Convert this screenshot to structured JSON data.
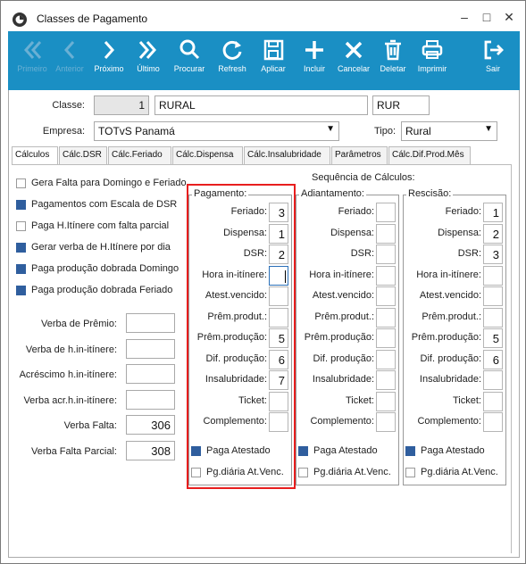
{
  "window": {
    "title": "Classes de Pagamento"
  },
  "toolbar": {
    "items": [
      {
        "label": "Primeiro",
        "icon": "first-icon",
        "enabled": false
      },
      {
        "label": "Anterior",
        "icon": "previous-icon",
        "enabled": false
      },
      {
        "label": "Próximo",
        "icon": "next-icon",
        "enabled": true
      },
      {
        "label": "Último",
        "icon": "last-icon",
        "enabled": true
      },
      {
        "label": "Procurar",
        "icon": "search-icon",
        "enabled": true
      },
      {
        "label": "Refresh",
        "icon": "refresh-icon",
        "enabled": true
      },
      {
        "label": "Aplicar",
        "icon": "save-icon",
        "enabled": true
      },
      {
        "label": "Incluir",
        "icon": "add-icon",
        "enabled": true
      },
      {
        "label": "Cancelar",
        "icon": "cancel-icon",
        "enabled": true
      },
      {
        "label": "Deletar",
        "icon": "trash-icon",
        "enabled": true
      },
      {
        "label": "Imprimir",
        "icon": "print-icon",
        "enabled": true
      },
      {
        "label": "Sair",
        "icon": "exit-icon",
        "enabled": true
      }
    ]
  },
  "form": {
    "classe_label": "Classe:",
    "classe_code": "1",
    "classe_name": "RURAL",
    "classe_abbr": "RUR",
    "empresa_label": "Empresa:",
    "empresa_value": "TOTvS Panamá",
    "tipo_label": "Tipo:",
    "tipo_value": "Rural"
  },
  "tabs": [
    "Cálculos",
    "Cálc.DSR",
    "Cálc.Feriado",
    "Cálc.Dispensa",
    "Cálc.Insalubridade",
    "Parâmetros",
    "Cálc.Dif.Prod.Mês"
  ],
  "checks": [
    {
      "label": "Gera Falta para Domingo e Feriado",
      "checked": false
    },
    {
      "label": "Pagamentos com Escala de DSR",
      "checked": true
    },
    {
      "label": "Paga H.Itínere com falta parcial",
      "checked": false
    },
    {
      "label": "Gerar verba de H.Itínere por dia",
      "checked": true
    },
    {
      "label": "Paga produção dobrada Domingo",
      "checked": true
    },
    {
      "label": "Paga produção dobrada Feriado",
      "checked": true
    }
  ],
  "verbas": [
    {
      "label": "Verba de Prêmio:",
      "value": ""
    },
    {
      "label": "Verba de h.in-itínere:",
      "value": ""
    },
    {
      "label": "Acréscimo h.in-itínere:",
      "value": ""
    },
    {
      "label": "Verba acr.h.in-itínere:",
      "value": ""
    },
    {
      "label": "Verba Falta:",
      "value": "306"
    },
    {
      "label": "Verba Falta Parcial:",
      "value": "308"
    }
  ],
  "sequencia_title": "Sequência de Cálculos:",
  "row_labels": [
    "Feriado:",
    "Dispensa:",
    "DSR:",
    "Hora in-itínere:",
    "Atest.vencido:",
    "Prêm.produt.:",
    "Prêm.produção:",
    "Dif. produção:",
    "Insalubridade:",
    "Ticket:",
    "Complemento:"
  ],
  "groups": [
    {
      "title": "Pagamento:",
      "values": [
        "3",
        "1",
        "2",
        "",
        "",
        "",
        "5",
        "6",
        "7",
        "",
        ""
      ],
      "atestado_label": "Paga Atestado",
      "atestado": true,
      "diaria_label": "Pg.diária At.Venc.",
      "diaria": false
    },
    {
      "title": "Adiantamento:",
      "values": [
        "",
        "",
        "",
        "",
        "",
        "",
        "",
        "",
        "",
        "",
        ""
      ],
      "atestado_label": "Paga Atestado",
      "atestado": true,
      "diaria_label": "Pg.diária At.Venc.",
      "diaria": false
    },
    {
      "title": "Rescisão:",
      "values": [
        "1",
        "2",
        "3",
        "",
        "",
        "",
        "5",
        "6",
        "",
        "",
        ""
      ],
      "atestado_label": "Paga Atestado",
      "atestado": true,
      "diaria_label": "Pg.diária At.Venc.",
      "diaria": false
    }
  ],
  "colors": {
    "toolbar": "#1a8fc4",
    "highlight": "#e81e1e",
    "checked": "#2f5e9e"
  }
}
